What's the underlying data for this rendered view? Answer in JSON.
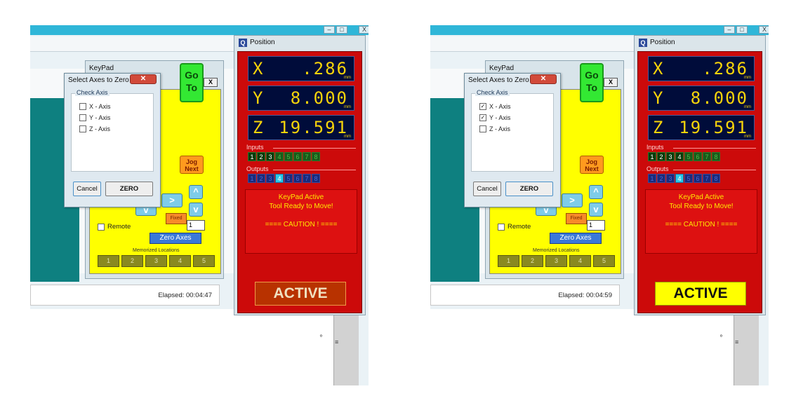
{
  "panels": [
    {
      "elapsed": "Elapsed: 00:04:47",
      "keypad": {
        "title": "KeyPad",
        "close": "X",
        "goto_line1": "Go",
        "goto_line2": "To",
        "jog_line1": "Jog",
        "jog_line2": "Next",
        "right_arrow": ">",
        "up_arrow": "^",
        "down_arrow": "v",
        "left_down_arrow": "v",
        "step_label": "Fixed",
        "step_value": "1",
        "remote": "Remote",
        "zero_axes": "Zero Axes",
        "memorized_label": "Memorized Locations",
        "memorized": [
          "1",
          "2",
          "3",
          "4",
          "5"
        ]
      },
      "dialog": {
        "title": "Select Axes to Zero",
        "group": "Check Axis",
        "axes": [
          {
            "label": "X - Axis",
            "mark": ""
          },
          {
            "label": "Y - Axis",
            "mark": ""
          },
          {
            "label": "Z - Axis",
            "mark": ""
          }
        ],
        "cancel": "Cancel",
        "zero": "ZERO"
      },
      "position": {
        "title": "Position",
        "x_axis": "X",
        "x_value": ".286",
        "y_axis": "Y",
        "y_value": "8.000",
        "z_axis": "Z",
        "z_value": "19.591",
        "unit": "mm",
        "inputs_label": "Inputs",
        "outputs_label": "Outputs",
        "inputs": [
          "1",
          "2",
          "3",
          "4",
          "5",
          "6",
          "7",
          "8"
        ],
        "outputs": [
          "1",
          "2",
          "3",
          "4",
          "5",
          "6",
          "7",
          "8"
        ],
        "msg1": "KeyPad Active",
        "msg2": "Tool Ready to Move!",
        "msg3": "==== CAUTION ! ====",
        "active": "ACTIVE"
      }
    },
    {
      "elapsed": "Elapsed: 00:04:59",
      "keypad": {
        "title": "KeyPad",
        "close": "X",
        "goto_line1": "Go",
        "goto_line2": "To",
        "jog_line1": "Jog",
        "jog_line2": "Next",
        "right_arrow": ">",
        "up_arrow": "^",
        "down_arrow": "v",
        "left_down_arrow": "v",
        "step_label": "Fixed",
        "step_value": "1",
        "remote": "Remote",
        "zero_axes": "Zero Axes",
        "memorized_label": "Memorized Locations",
        "memorized": [
          "1",
          "2",
          "3",
          "4",
          "5"
        ]
      },
      "dialog": {
        "title": "Select Axes to Zero",
        "group": "Check Axis",
        "axes": [
          {
            "label": "X - Axis",
            "mark": "✓"
          },
          {
            "label": "Y - Axis",
            "mark": "✓"
          },
          {
            "label": "Z - Axis",
            "mark": ""
          }
        ],
        "cancel": "Cancel",
        "zero": "ZERO"
      },
      "position": {
        "title": "Position",
        "x_axis": "X",
        "x_value": ".286",
        "y_axis": "Y",
        "y_value": "8.000",
        "z_axis": "Z",
        "z_value": "19.591",
        "unit": "mm",
        "inputs_label": "Inputs",
        "outputs_label": "Outputs",
        "inputs": [
          "1",
          "2",
          "3",
          "4",
          "5",
          "6",
          "7",
          "8"
        ],
        "outputs": [
          "1",
          "2",
          "3",
          "4",
          "5",
          "6",
          "7",
          "8"
        ],
        "msg1": "KeyPad Active",
        "msg2": "Tool Ready to Move!",
        "msg3": "==== CAUTION ! ====",
        "active": "ACTIVE"
      }
    }
  ],
  "window_controls": {
    "minimize": "–",
    "maximize": "□",
    "close": "X"
  },
  "scroll_mark": "≡",
  "dot": "º",
  "colors": {
    "teal": "#0e8080",
    "keypad_yellow": "#ffff00",
    "dro_background": "#000c3a",
    "dro_digits": "#f7d40a",
    "position_red": "#cc0a0a",
    "active_off": "#b83200",
    "active_on": "#ffff00"
  }
}
